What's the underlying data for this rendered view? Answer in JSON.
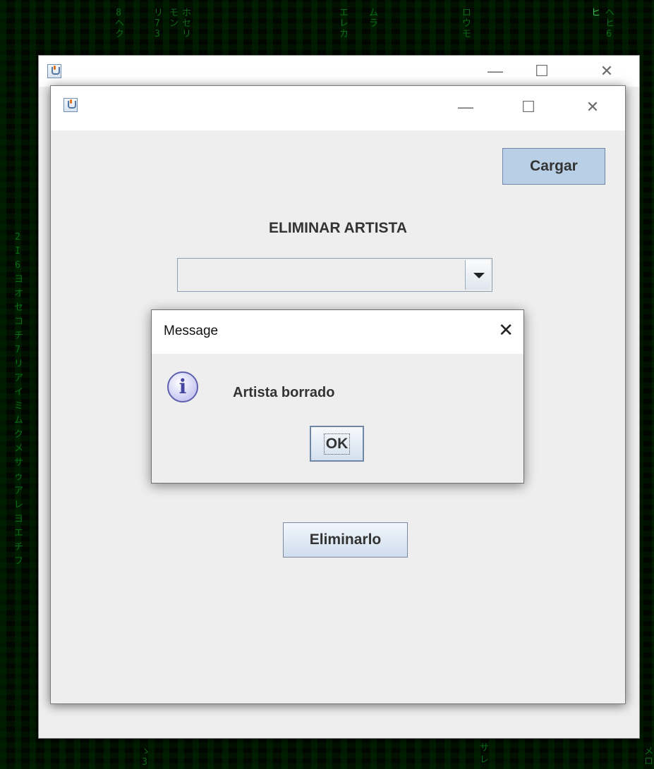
{
  "back_window": {
    "title": "",
    "icon": "java-icon",
    "controls": {
      "minimize": "—",
      "maximize": "☐",
      "close": "✕"
    }
  },
  "main_window": {
    "title": "",
    "icon": "java-icon",
    "controls": {
      "minimize": "—",
      "maximize": "☐",
      "close": "✕"
    },
    "load_button": "Cargar",
    "heading": "ELIMINAR ARTISTA",
    "artist_combo": {
      "selected": "",
      "arrow_icon": "chevron-down-icon"
    },
    "delete_button": "Eliminarlo"
  },
  "dialog": {
    "title": "Message",
    "close": "✕",
    "icon": "info-icon",
    "icon_glyph": "i",
    "message": "Artista borrado",
    "ok_button": "OK"
  },
  "colors": {
    "desktop": "#020702",
    "matrix_green": "#0c7a1a",
    "window_bg": "#eeeeee",
    "button_accent": "#b8cfe5"
  }
}
